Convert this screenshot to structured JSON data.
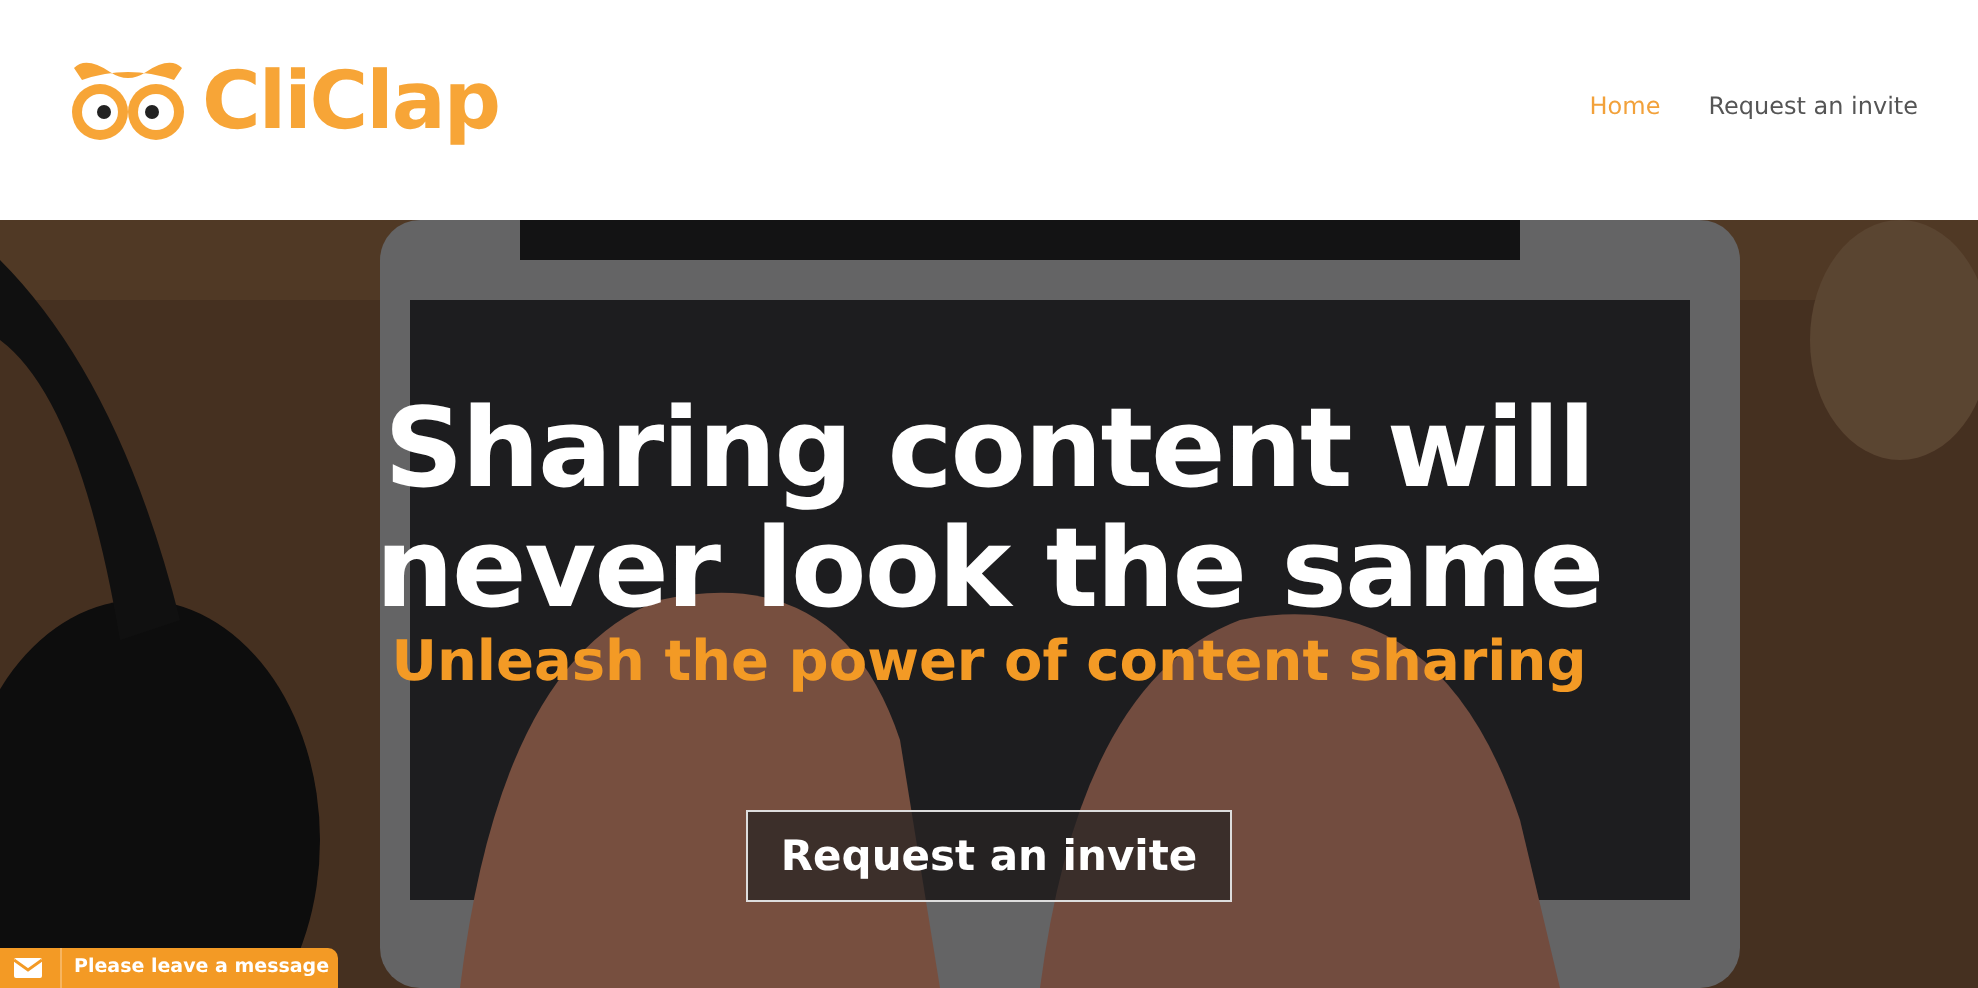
{
  "header": {
    "logo_text": "CliClap"
  },
  "nav": [
    {
      "label": "Home",
      "selected": true
    },
    {
      "label": "Request an invite",
      "selected": false
    }
  ],
  "hero": {
    "kind": "picture",
    "title": "Sharing content will never look the same",
    "subtitle": "Unleash the power of content sharing",
    "button": "Request an invite"
  },
  "chat_tab": {
    "label": "Please leave a message"
  }
}
